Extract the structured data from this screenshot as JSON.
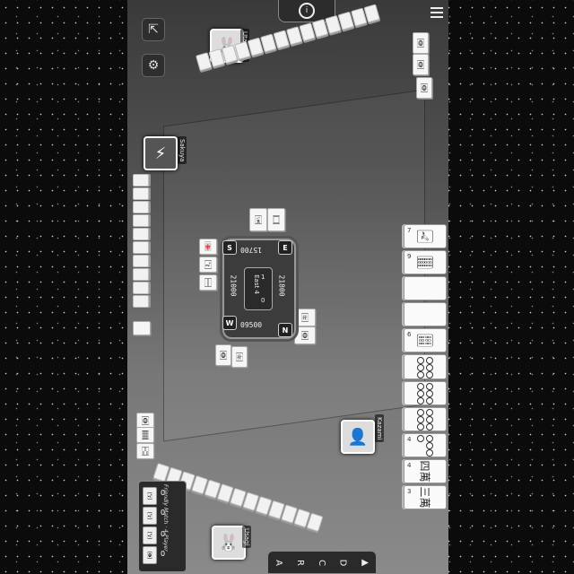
{
  "scores": {
    "top": "15700",
    "right": "21800",
    "bottom": "09500",
    "left": "21000"
  },
  "round": {
    "label": "East 4",
    "honba": "1",
    "riichi": "0"
  },
  "winds": {
    "s": "S",
    "e": "E",
    "w": "W",
    "n": "N"
  },
  "players": {
    "top": {
      "name": "Utamaru",
      "avatar_icon": "rabbit-icon"
    },
    "left": {
      "name": "Sakuya",
      "avatar_icon": "lightning-icon"
    },
    "right": {
      "name": "Kazami",
      "avatar_icon": "character-icon"
    },
    "bottom": {
      "name": "Usagi",
      "avatar_icon": "rabbit-icon"
    }
  },
  "hand_tiles": [
    {
      "num": "7",
      "glyph": "🀐",
      "type": "bamboo"
    },
    {
      "num": "9",
      "glyph": "🀘",
      "type": "bamboo"
    },
    {
      "num": "",
      "glyph": "",
      "type": "white"
    },
    {
      "num": "",
      "glyph": "",
      "type": "white"
    },
    {
      "num": "6",
      "glyph": "🀕",
      "type": "bamboo"
    },
    {
      "num": "",
      "glyph": "🀞",
      "type": "circle"
    },
    {
      "num": "",
      "glyph": "🀟",
      "type": "circle"
    },
    {
      "num": "",
      "glyph": "🀡",
      "type": "circle"
    },
    {
      "num": "4",
      "glyph": "🀜",
      "type": "circle"
    },
    {
      "num": "4",
      "glyph": "四萬",
      "type": "char"
    },
    {
      "num": "3",
      "glyph": "三萬",
      "type": "char"
    }
  ],
  "mode_label": "Friendly Match · 4-Player",
  "counts": {
    "a": "0",
    "b": "0",
    "c": "0",
    "d": "0"
  },
  "bottom_bar": [
    "A",
    "R",
    "C",
    "D",
    "▲"
  ]
}
